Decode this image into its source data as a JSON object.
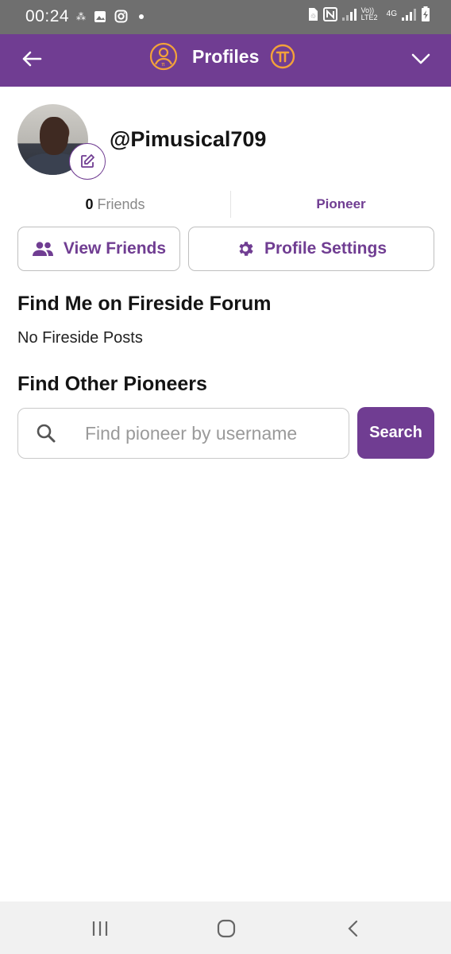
{
  "status_bar": {
    "time": "00:24",
    "left_icons": [
      "notification-dot-icon",
      "gallery-icon",
      "instagram-icon",
      "dot-icon"
    ],
    "right_icons": [
      "sim-icon",
      "nfc-icon",
      "signal-icon",
      "volte-icon",
      "4g-icon",
      "signal-icon",
      "battery-charging-icon"
    ],
    "volte_label": "Vo)) LTE2",
    "network_label": "4G"
  },
  "header": {
    "title": "Profiles",
    "back_icon": "arrow-left-icon",
    "profile_icon": "profile-pi-icon",
    "pi_icon": "pi-coin-icon",
    "menu_icon": "chevron-down-icon",
    "color": "#703d92"
  },
  "profile": {
    "username": "@Pimusical709",
    "friends_count": "0",
    "friends_label": "Friends",
    "role": "Pioneer"
  },
  "actions": {
    "view_friends": "View Friends",
    "profile_settings": "Profile Settings"
  },
  "fireside": {
    "heading": "Find Me on Fireside Forum",
    "empty_text": "No Fireside Posts"
  },
  "find_pioneers": {
    "heading": "Find Other Pioneers",
    "placeholder": "Find pioneer by username",
    "value": "",
    "search_label": "Search"
  },
  "nav_bar": {
    "icons": [
      "recent-apps-icon",
      "home-icon",
      "back-icon"
    ]
  },
  "colors": {
    "accent": "#703d92",
    "gold": "#f3a23a",
    "status_bar": "#6f6f6f"
  }
}
